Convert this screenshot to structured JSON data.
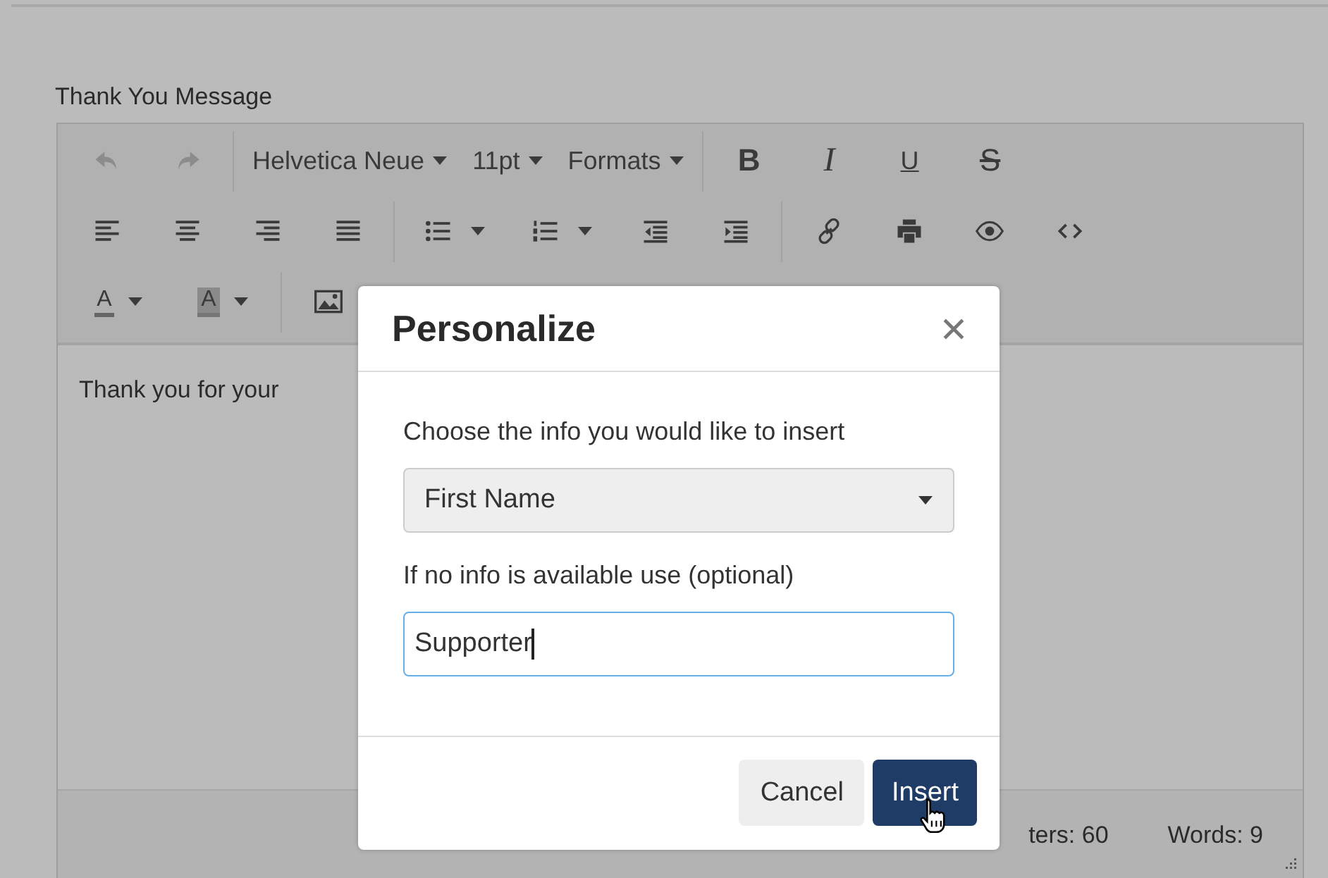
{
  "field_label": "Thank You Message",
  "toolbar": {
    "rows": [
      [
        [
          {
            "kind": "undo",
            "disabled": true
          },
          {
            "kind": "redo",
            "disabled": true
          }
        ],
        [
          {
            "kind": "dropdown",
            "label": "Helvetica Neue",
            "disabled": false
          },
          {
            "kind": "dropdown",
            "label": "11pt",
            "disabled": false
          },
          {
            "kind": "dropdown",
            "label": "Formats",
            "disabled": false
          }
        ],
        [
          {
            "kind": "bold",
            "label": "B",
            "disabled": false
          },
          {
            "kind": "italic",
            "label": "I",
            "disabled": false
          },
          {
            "kind": "underline",
            "label": "U",
            "disabled": false
          },
          {
            "kind": "strike",
            "label": "S",
            "disabled": false
          }
        ]
      ],
      [
        [
          {
            "kind": "alignleft",
            "disabled": false
          },
          {
            "kind": "aligncenter",
            "disabled": false
          },
          {
            "kind": "alignright",
            "disabled": false
          },
          {
            "kind": "justify",
            "disabled": false
          }
        ],
        [
          {
            "kind": "bullets",
            "disabled": false
          },
          {
            "kind": "numbers",
            "disabled": false
          },
          {
            "kind": "outdent",
            "disabled": false
          },
          {
            "kind": "indent",
            "disabled": false
          }
        ],
        [
          {
            "kind": "link",
            "disabled": false
          },
          {
            "kind": "print",
            "disabled": false
          },
          {
            "kind": "preview",
            "disabled": false
          },
          {
            "kind": "code",
            "disabled": false
          }
        ]
      ],
      [
        [
          {
            "kind": "textcolor",
            "label": "A",
            "disabled": false
          },
          {
            "kind": "highlight",
            "label": "A",
            "disabled": false
          }
        ],
        [
          {
            "kind": "image",
            "disabled": false
          }
        ]
      ]
    ]
  },
  "content": "Thank you for your",
  "status_bar": [
    "ters: 60",
    "Words: 9"
  ],
  "dialog": {
    "title": "Personalize",
    "select_label": "Choose the info you would like to insert",
    "select_value": "First Name",
    "fallback_label": "If no info is available use (optional)",
    "fallback_value": "Supporter",
    "buttons": [
      {
        "label": "Cancel",
        "kind": "secondary"
      },
      {
        "label": "Insert",
        "kind": "primary"
      }
    ]
  }
}
